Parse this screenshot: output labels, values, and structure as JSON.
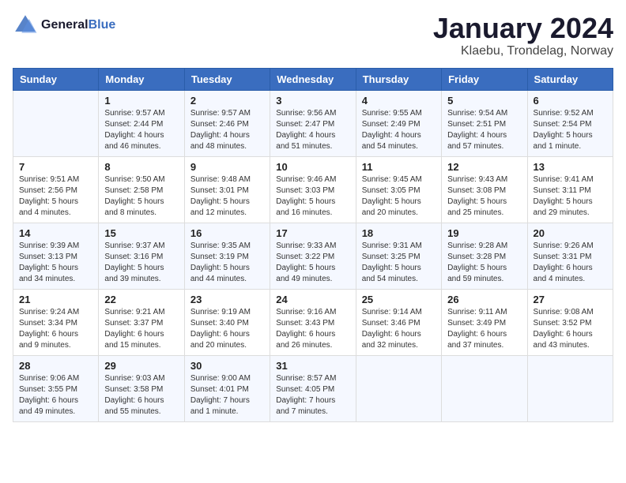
{
  "logo": {
    "general": "General",
    "blue": "Blue"
  },
  "title": "January 2024",
  "subtitle": "Klaebu, Trondelag, Norway",
  "days_of_week": [
    "Sunday",
    "Monday",
    "Tuesday",
    "Wednesday",
    "Thursday",
    "Friday",
    "Saturday"
  ],
  "weeks": [
    [
      {
        "num": "",
        "info": ""
      },
      {
        "num": "1",
        "info": "Sunrise: 9:57 AM\nSunset: 2:44 PM\nDaylight: 4 hours\nand 46 minutes."
      },
      {
        "num": "2",
        "info": "Sunrise: 9:57 AM\nSunset: 2:46 PM\nDaylight: 4 hours\nand 48 minutes."
      },
      {
        "num": "3",
        "info": "Sunrise: 9:56 AM\nSunset: 2:47 PM\nDaylight: 4 hours\nand 51 minutes."
      },
      {
        "num": "4",
        "info": "Sunrise: 9:55 AM\nSunset: 2:49 PM\nDaylight: 4 hours\nand 54 minutes."
      },
      {
        "num": "5",
        "info": "Sunrise: 9:54 AM\nSunset: 2:51 PM\nDaylight: 4 hours\nand 57 minutes."
      },
      {
        "num": "6",
        "info": "Sunrise: 9:52 AM\nSunset: 2:54 PM\nDaylight: 5 hours\nand 1 minute."
      }
    ],
    [
      {
        "num": "7",
        "info": "Sunrise: 9:51 AM\nSunset: 2:56 PM\nDaylight: 5 hours\nand 4 minutes."
      },
      {
        "num": "8",
        "info": "Sunrise: 9:50 AM\nSunset: 2:58 PM\nDaylight: 5 hours\nand 8 minutes."
      },
      {
        "num": "9",
        "info": "Sunrise: 9:48 AM\nSunset: 3:01 PM\nDaylight: 5 hours\nand 12 minutes."
      },
      {
        "num": "10",
        "info": "Sunrise: 9:46 AM\nSunset: 3:03 PM\nDaylight: 5 hours\nand 16 minutes."
      },
      {
        "num": "11",
        "info": "Sunrise: 9:45 AM\nSunset: 3:05 PM\nDaylight: 5 hours\nand 20 minutes."
      },
      {
        "num": "12",
        "info": "Sunrise: 9:43 AM\nSunset: 3:08 PM\nDaylight: 5 hours\nand 25 minutes."
      },
      {
        "num": "13",
        "info": "Sunrise: 9:41 AM\nSunset: 3:11 PM\nDaylight: 5 hours\nand 29 minutes."
      }
    ],
    [
      {
        "num": "14",
        "info": "Sunrise: 9:39 AM\nSunset: 3:13 PM\nDaylight: 5 hours\nand 34 minutes."
      },
      {
        "num": "15",
        "info": "Sunrise: 9:37 AM\nSunset: 3:16 PM\nDaylight: 5 hours\nand 39 minutes."
      },
      {
        "num": "16",
        "info": "Sunrise: 9:35 AM\nSunset: 3:19 PM\nDaylight: 5 hours\nand 44 minutes."
      },
      {
        "num": "17",
        "info": "Sunrise: 9:33 AM\nSunset: 3:22 PM\nDaylight: 5 hours\nand 49 minutes."
      },
      {
        "num": "18",
        "info": "Sunrise: 9:31 AM\nSunset: 3:25 PM\nDaylight: 5 hours\nand 54 minutes."
      },
      {
        "num": "19",
        "info": "Sunrise: 9:28 AM\nSunset: 3:28 PM\nDaylight: 5 hours\nand 59 minutes."
      },
      {
        "num": "20",
        "info": "Sunrise: 9:26 AM\nSunset: 3:31 PM\nDaylight: 6 hours\nand 4 minutes."
      }
    ],
    [
      {
        "num": "21",
        "info": "Sunrise: 9:24 AM\nSunset: 3:34 PM\nDaylight: 6 hours\nand 9 minutes."
      },
      {
        "num": "22",
        "info": "Sunrise: 9:21 AM\nSunset: 3:37 PM\nDaylight: 6 hours\nand 15 minutes."
      },
      {
        "num": "23",
        "info": "Sunrise: 9:19 AM\nSunset: 3:40 PM\nDaylight: 6 hours\nand 20 minutes."
      },
      {
        "num": "24",
        "info": "Sunrise: 9:16 AM\nSunset: 3:43 PM\nDaylight: 6 hours\nand 26 minutes."
      },
      {
        "num": "25",
        "info": "Sunrise: 9:14 AM\nSunset: 3:46 PM\nDaylight: 6 hours\nand 32 minutes."
      },
      {
        "num": "26",
        "info": "Sunrise: 9:11 AM\nSunset: 3:49 PM\nDaylight: 6 hours\nand 37 minutes."
      },
      {
        "num": "27",
        "info": "Sunrise: 9:08 AM\nSunset: 3:52 PM\nDaylight: 6 hours\nand 43 minutes."
      }
    ],
    [
      {
        "num": "28",
        "info": "Sunrise: 9:06 AM\nSunset: 3:55 PM\nDaylight: 6 hours\nand 49 minutes."
      },
      {
        "num": "29",
        "info": "Sunrise: 9:03 AM\nSunset: 3:58 PM\nDaylight: 6 hours\nand 55 minutes."
      },
      {
        "num": "30",
        "info": "Sunrise: 9:00 AM\nSunset: 4:01 PM\nDaylight: 7 hours\nand 1 minute."
      },
      {
        "num": "31",
        "info": "Sunrise: 8:57 AM\nSunset: 4:05 PM\nDaylight: 7 hours\nand 7 minutes."
      },
      {
        "num": "",
        "info": ""
      },
      {
        "num": "",
        "info": ""
      },
      {
        "num": "",
        "info": ""
      }
    ]
  ]
}
